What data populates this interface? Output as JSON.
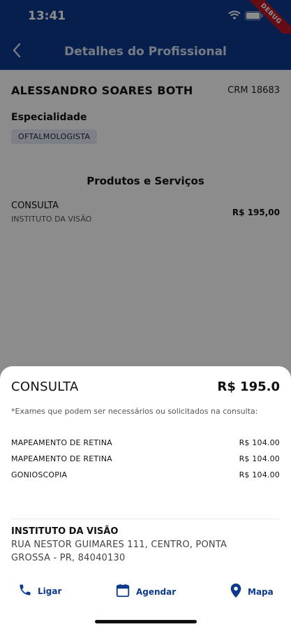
{
  "status_bar": {
    "time": "13:41",
    "debug_label": "DEBUG"
  },
  "app_bar": {
    "title": "Detalhes do Profissional"
  },
  "professional": {
    "name": "ALESSANDRO SOARES BOTH",
    "crm": "CRM 18683",
    "specialty_label": "Especialidade",
    "specialty": "OFTALMOLOGISTA"
  },
  "products": {
    "title": "Produtos e Serviços",
    "items": [
      {
        "name": "CONSULTA",
        "place": "INSTITUTO DA VISÃO",
        "price": "R$ 195,00"
      }
    ]
  },
  "sheet": {
    "title": "CONSULTA",
    "price": "R$ 195.0",
    "note": "*Exames que podem ser necessários ou solicitados na consulta:",
    "exams": [
      {
        "name": "MAPEAMENTO DE RETINA",
        "price": "R$ 104.00"
      },
      {
        "name": "MAPEAMENTO DE RETINA",
        "price": "R$ 104.00"
      },
      {
        "name": "GONIOSCOPIA",
        "price": "R$ 104.00"
      }
    ],
    "place_name": "INSTITUTO DA VISÃO",
    "place_address": "RUA NESTOR GUIMARES 111, CENTRO, PONTA GROSSA - PR, 84040130",
    "actions": {
      "call": "Ligar",
      "schedule": "Agendar",
      "map": "Mapa"
    }
  },
  "colors": {
    "primary": "#0d3a8a",
    "chip_bg": "#e3ecf6",
    "debug": "#b8162b"
  },
  "icons": [
    "back-arrow-icon",
    "wifi-icon",
    "battery-icon",
    "phone-icon",
    "calendar-icon",
    "location-pin-icon"
  ]
}
